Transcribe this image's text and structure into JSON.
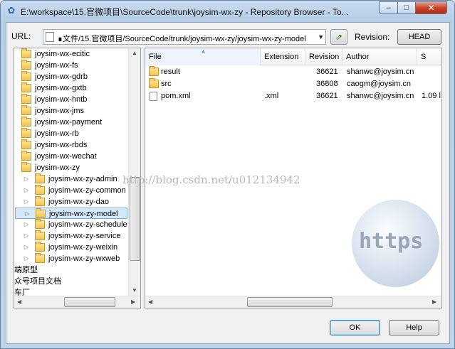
{
  "window": {
    "title": "E:\\workspace\\15.官微项目\\SourceCode\\trunk\\joysim-wx-zy - Repository Browser - To...",
    "minimize": "–",
    "maximize": "□",
    "close": "✕"
  },
  "toolbar": {
    "url_label": "URL:",
    "url_value": "∎文件/15.官微项目/SourceCode/trunk/joysim-wx-zy/joysim-wx-zy-model",
    "revision_label": "Revision:",
    "revision_button": "HEAD"
  },
  "tree": {
    "items": [
      {
        "label": "joysim-wx-ecitic"
      },
      {
        "label": "joysim-wx-fs"
      },
      {
        "label": "joysim-wx-gdrb"
      },
      {
        "label": "joysim-wx-gxtb"
      },
      {
        "label": "joysim-wx-hntb"
      },
      {
        "label": "joysim-wx-jms"
      },
      {
        "label": "joysim-wx-payment"
      },
      {
        "label": "joysim-wx-rb"
      },
      {
        "label": "joysim-wx-rbds"
      },
      {
        "label": "joysim-wx-wechat"
      },
      {
        "label": "joysim-wx-zy"
      },
      {
        "label": "joysim-wx-zy-admin"
      },
      {
        "label": "joysim-wx-zy-common"
      },
      {
        "label": "joysim-wx-zy-dao"
      },
      {
        "label": "joysim-wx-zy-model"
      },
      {
        "label": "joysim-wx-zy-schedule"
      },
      {
        "label": "joysim-wx-zy-service"
      },
      {
        "label": "joysim-wx-zy-weixin"
      },
      {
        "label": "joysim-wx-zy-wxweb"
      },
      {
        "label": "端原型"
      },
      {
        "label": "众号项目文档"
      },
      {
        "label": "车厂"
      }
    ]
  },
  "list": {
    "columns": [
      "File",
      "Extension",
      "Revision",
      "Author",
      "S"
    ],
    "rows": [
      {
        "file": "result",
        "extension": "",
        "revision": "36621",
        "author": "shanwc@joysim.cn",
        "size": ""
      },
      {
        "file": "src",
        "extension": "",
        "revision": "36808",
        "author": "caogm@joysim.cn",
        "size": ""
      },
      {
        "file": "pom.xml",
        "extension": ".xml",
        "revision": "36621",
        "author": "shanwc@joysim.cn",
        "size": "1.09 l"
      }
    ]
  },
  "watermark": "http://blog.csdn.net/u012134942",
  "globe_text": "https",
  "buttons": {
    "ok": "OK",
    "help": "Help"
  }
}
